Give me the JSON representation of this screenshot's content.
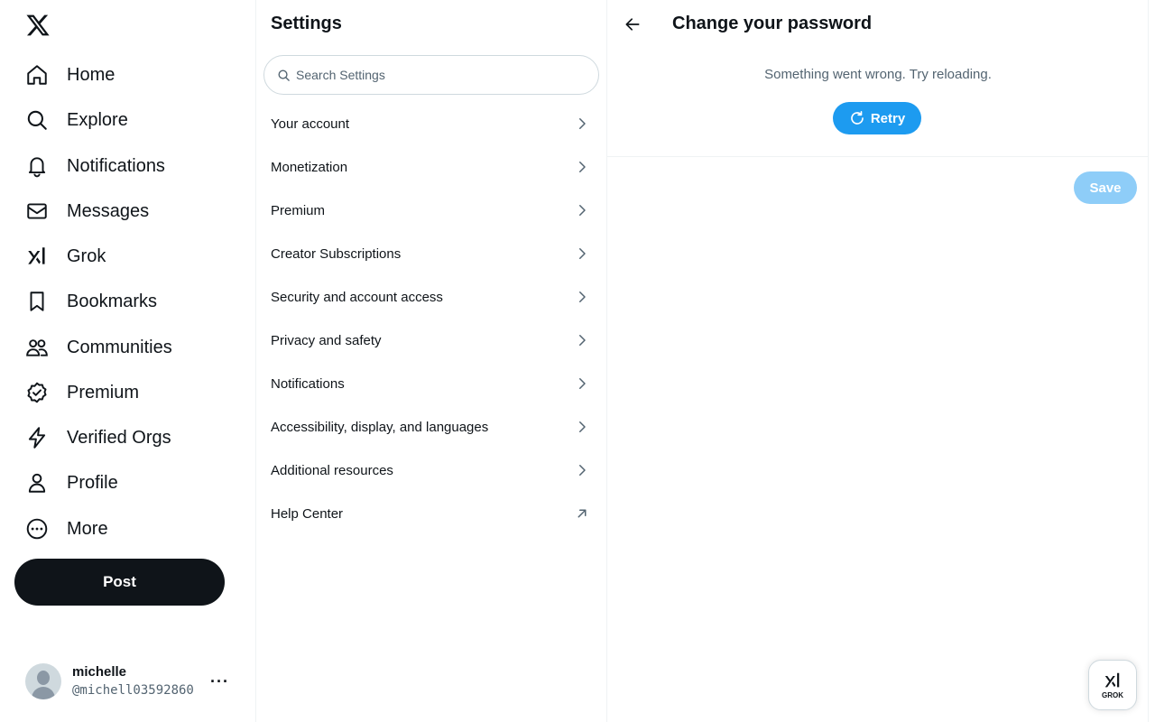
{
  "nav": {
    "items": [
      {
        "label": "Home",
        "icon": "home-icon"
      },
      {
        "label": "Explore",
        "icon": "search-icon"
      },
      {
        "label": "Notifications",
        "icon": "bell-icon"
      },
      {
        "label": "Messages",
        "icon": "envelope-icon"
      },
      {
        "label": "Grok",
        "icon": "grok-icon"
      },
      {
        "label": "Bookmarks",
        "icon": "bookmark-icon"
      },
      {
        "label": "Communities",
        "icon": "people-icon"
      },
      {
        "label": "Premium",
        "icon": "verified-badge-icon"
      },
      {
        "label": "Verified Orgs",
        "icon": "lightning-icon"
      },
      {
        "label": "Profile",
        "icon": "person-icon"
      },
      {
        "label": "More",
        "icon": "more-circle-icon"
      }
    ],
    "post_label": "Post"
  },
  "account": {
    "name": "michelle",
    "handle": "@michell03592860",
    "more_label": "···"
  },
  "settings": {
    "title": "Settings",
    "search_placeholder": "Search Settings",
    "items": [
      {
        "label": "Your account",
        "icon": "chevron-right-icon"
      },
      {
        "label": "Monetization",
        "icon": "chevron-right-icon"
      },
      {
        "label": "Premium",
        "icon": "chevron-right-icon"
      },
      {
        "label": "Creator Subscriptions",
        "icon": "chevron-right-icon"
      },
      {
        "label": "Security and account access",
        "icon": "chevron-right-icon"
      },
      {
        "label": "Privacy and safety",
        "icon": "chevron-right-icon"
      },
      {
        "label": "Notifications",
        "icon": "chevron-right-icon"
      },
      {
        "label": "Accessibility, display, and languages",
        "icon": "chevron-right-icon"
      },
      {
        "label": "Additional resources",
        "icon": "chevron-right-icon"
      },
      {
        "label": "Help Center",
        "icon": "external-link-icon"
      }
    ]
  },
  "main": {
    "title": "Change your password",
    "error_message": "Something went wrong. Try reloading.",
    "retry_label": "Retry",
    "save_label": "Save"
  },
  "grok_fab": {
    "label": "GROK"
  },
  "colors": {
    "accent": "#1d9bf0",
    "save_disabled": "#8ecdf8",
    "text_primary": "#0f1419",
    "text_secondary": "#536471",
    "border": "#eff3f4"
  }
}
